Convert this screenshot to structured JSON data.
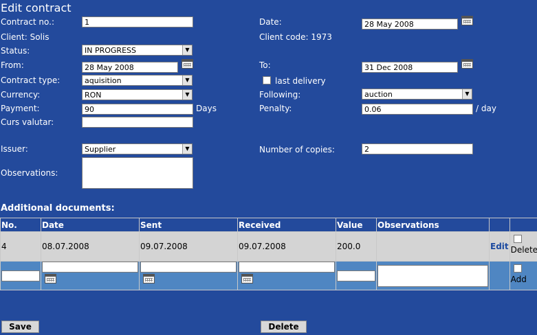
{
  "form": {
    "title": "Edit contract",
    "contract_no": {
      "label": "Contract no.:",
      "value": "1"
    },
    "date": {
      "label": "Date:",
      "value": "28 May 2008"
    },
    "client": {
      "label": "Client: Solis"
    },
    "client_code": {
      "label": "Client code: 1973"
    },
    "status": {
      "label": "Status:",
      "value": "IN PROGRESS"
    },
    "from": {
      "label": "From:",
      "value": "28 May 2008"
    },
    "to": {
      "label": "To:",
      "value": "31 Dec 2008"
    },
    "contract_type": {
      "label": "Contract type:",
      "value": "aquisition"
    },
    "last_delivery": {
      "label": "last delivery"
    },
    "currency": {
      "label": "Currency:",
      "value": "RON"
    },
    "following": {
      "label": "Following:",
      "value": "auction"
    },
    "payment": {
      "label": "Payment:",
      "value": "90",
      "unit": "Days"
    },
    "penalty": {
      "label": "Penalty:",
      "value": "0.06",
      "unit": "/ day"
    },
    "curs_valutar": {
      "label": "Curs valutar:",
      "value": ""
    },
    "issuer": {
      "label": "Issuer:",
      "value": "Supplier"
    },
    "copies": {
      "label": "Number of copies:",
      "value": "2"
    },
    "observations": {
      "label": "Observations:",
      "value": ""
    }
  },
  "docs": {
    "title": "Additional documents:",
    "headers": [
      "No.",
      "Date",
      "Sent",
      "Received",
      "Value",
      "Observations",
      "",
      ""
    ],
    "rows": [
      {
        "no": "4",
        "date": "08.07.2008",
        "sent": "09.07.2008",
        "received": "09.07.2008",
        "value": "200.0",
        "observations": "",
        "edit": "Edit",
        "delete": "Delete"
      }
    ],
    "add_label": "Add"
  },
  "buttons": {
    "save": "Save",
    "delete": "Delete"
  },
  "icons": {
    "calendar": "calendar-icon",
    "dropdown": "chevron-down-icon"
  },
  "colors": {
    "background": "#234a9c",
    "table_row": "#d4d4d4",
    "add_row": "#4f86c2"
  }
}
